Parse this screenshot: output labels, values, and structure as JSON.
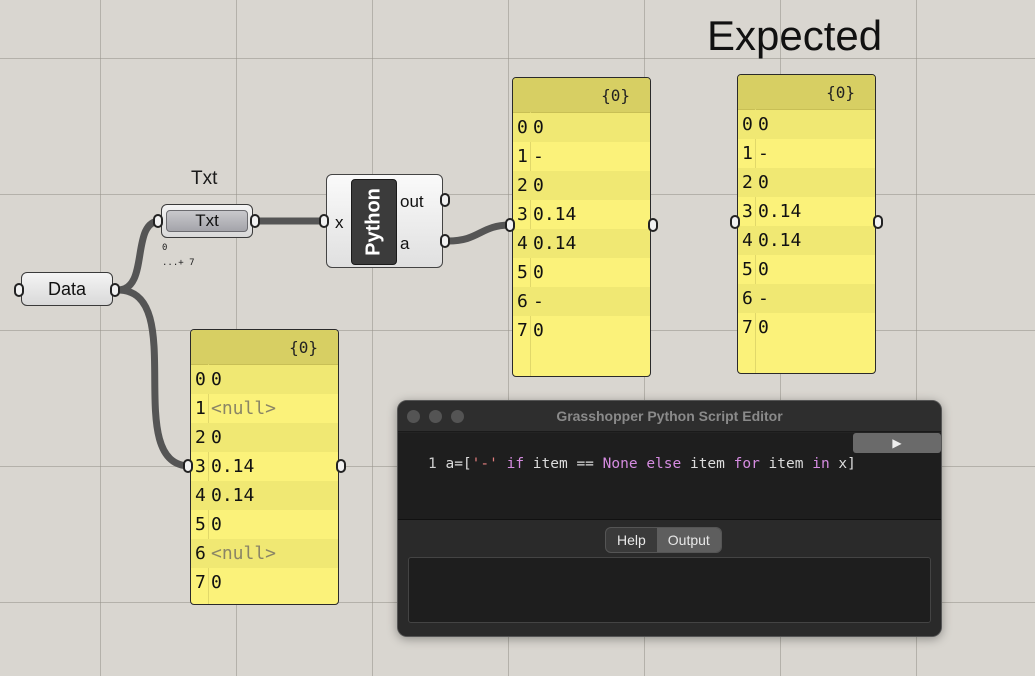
{
  "canvas_title": "Expected",
  "data_param": {
    "label": "Data"
  },
  "txt_component": {
    "floating_label": "Txt",
    "label": "Txt",
    "tiny_info": [
      "0",
      "...+ 7"
    ]
  },
  "python_component": {
    "name": "Python",
    "input": "x",
    "outputs": [
      "out",
      "a"
    ]
  },
  "panels": {
    "input_panel": {
      "header": "{0}",
      "rows": [
        {
          "index": "0",
          "value": "0"
        },
        {
          "index": "1",
          "value": "<null>"
        },
        {
          "index": "2",
          "value": "0"
        },
        {
          "index": "3",
          "value": "0.14"
        },
        {
          "index": "4",
          "value": "0.14"
        },
        {
          "index": "5",
          "value": "0"
        },
        {
          "index": "6",
          "value": "<null>"
        },
        {
          "index": "7",
          "value": "0"
        }
      ]
    },
    "output_panel": {
      "header": "{0}",
      "rows": [
        {
          "index": "0",
          "value": "0"
        },
        {
          "index": "1",
          "value": "-"
        },
        {
          "index": "2",
          "value": "0"
        },
        {
          "index": "3",
          "value": "0.14"
        },
        {
          "index": "4",
          "value": "0.14"
        },
        {
          "index": "5",
          "value": "0"
        },
        {
          "index": "6",
          "value": "-"
        },
        {
          "index": "7",
          "value": "0"
        }
      ]
    },
    "expected_panel": {
      "header": "{0}",
      "rows": [
        {
          "index": "0",
          "value": "0"
        },
        {
          "index": "1",
          "value": "-"
        },
        {
          "index": "2",
          "value": "0"
        },
        {
          "index": "3",
          "value": "0.14"
        },
        {
          "index": "4",
          "value": "0.14"
        },
        {
          "index": "5",
          "value": "0"
        },
        {
          "index": "6",
          "value": "-"
        },
        {
          "index": "7",
          "value": "0"
        }
      ]
    }
  },
  "editor": {
    "title": "Grasshopper Python Script Editor",
    "run_icon": "play-icon",
    "run_glyph": "▶",
    "code_line_number": "1",
    "code_tokens": {
      "t1": "a=[",
      "t2": "'-'",
      "t3": " ",
      "t4": "if",
      "t5": " item == ",
      "t6": "None",
      "t7": " ",
      "t8": "else",
      "t9": " item ",
      "t10": "for",
      "t11": " item ",
      "t12": "in",
      "t13": " x]"
    },
    "tabs": [
      "Help",
      "Output"
    ],
    "active_tab": "Output"
  },
  "colors": {
    "canvas": "#d9d6d0",
    "panel_yellow": "#fbf27a",
    "wire": "#555555"
  }
}
